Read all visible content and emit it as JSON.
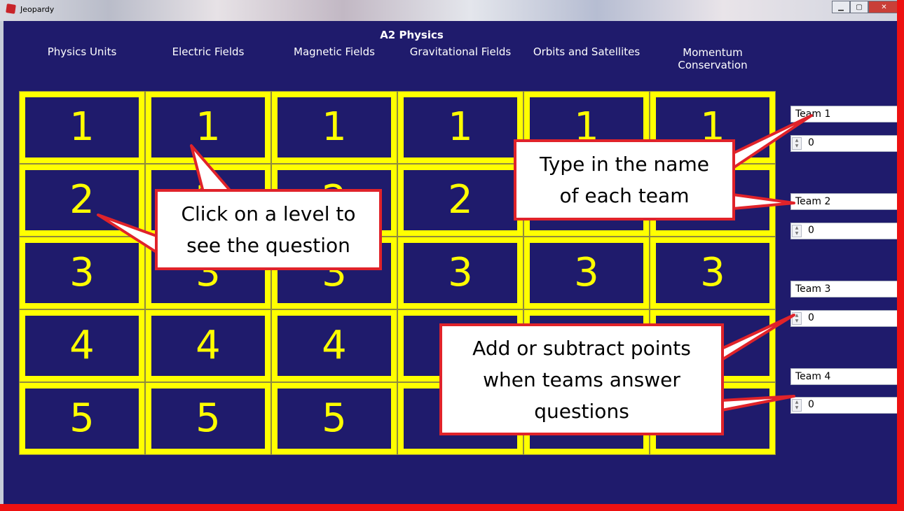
{
  "window": {
    "title": "Jeopardy"
  },
  "board": {
    "title": "A2 Physics",
    "categories": [
      "Physics Units",
      "Electric Fields",
      "Magnetic Fields",
      "Gravitational Fields",
      "Orbits and Satellites",
      "Momentum Conservation"
    ],
    "levels": [
      "1",
      "2",
      "3",
      "4",
      "5"
    ]
  },
  "teams": [
    {
      "name": "Team 1",
      "score": "0"
    },
    {
      "name": "Team 2",
      "score": "0"
    },
    {
      "name": "Team 3",
      "score": "0"
    },
    {
      "name": "Team 4",
      "score": "0"
    }
  ],
  "callouts": {
    "click_level": "Click on a level to see the question",
    "team_names": "Type in the name of each team",
    "points": "Add or subtract points when teams answer questions"
  },
  "colors": {
    "board_bg": "#1f1b6c",
    "tile_yellow": "#ffff00",
    "callout_border": "#e0232a"
  },
  "icons": {
    "close": "close-icon",
    "minimize": "minimize-icon",
    "maximize": "maximize-icon",
    "app": "jeopardy-app-icon"
  }
}
